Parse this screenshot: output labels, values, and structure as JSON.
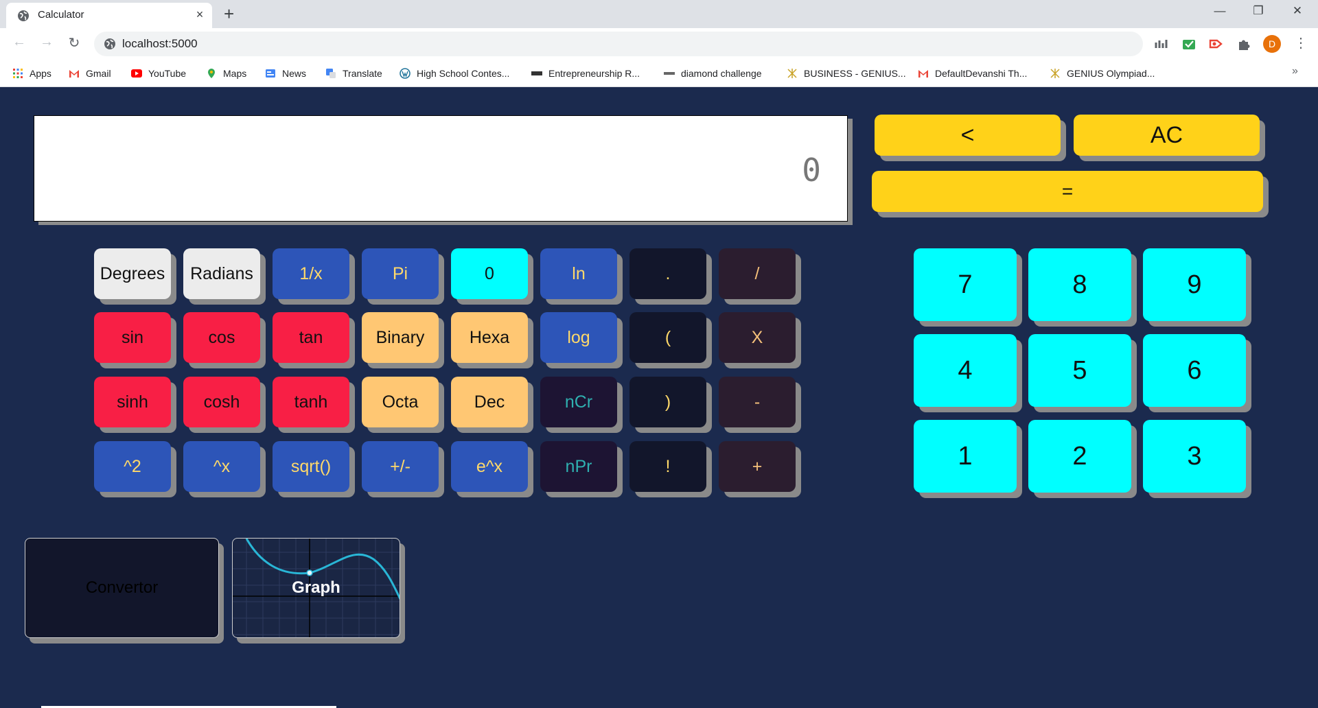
{
  "browser": {
    "tab_title": "Calculator",
    "tab_close": "×",
    "new_tab": "+",
    "window_controls": {
      "minimize": "—",
      "maximize": "❐",
      "close": "✕"
    },
    "nav": {
      "back": "←",
      "forward": "→",
      "reload": "↻"
    },
    "url": "localhost:5000",
    "avatar_letter": "D",
    "menu": "⋮",
    "bookmarks": [
      {
        "label": "Apps",
        "icon": "apps-grid-icon"
      },
      {
        "label": "Gmail",
        "icon": "gmail-icon"
      },
      {
        "label": "YouTube",
        "icon": "youtube-icon"
      },
      {
        "label": "Maps",
        "icon": "maps-pin-icon"
      },
      {
        "label": "News",
        "icon": "news-icon"
      },
      {
        "label": "Translate",
        "icon": "translate-icon"
      },
      {
        "label": "High School Contes...",
        "icon": "wordpress-icon"
      },
      {
        "label": "Entrepreneurship R...",
        "icon": "site-icon"
      },
      {
        "label": "diamond challenge",
        "icon": "site-icon"
      },
      {
        "label": "BUSINESS - GENIUS...",
        "icon": "genius-icon"
      },
      {
        "label": "DefaultDevanshi Th...",
        "icon": "gmail-icon"
      },
      {
        "label": "GENIUS Olympiad...",
        "icon": "genius-icon"
      }
    ],
    "bookmarks_more": "»"
  },
  "calculator": {
    "display_value": "0",
    "top_keys": {
      "backspace": "<",
      "clear": "AC",
      "equals": "="
    },
    "scientific_keys": [
      [
        "Degrees",
        "Radians",
        "1/x",
        "Pi",
        "0",
        "ln",
        ".",
        "/"
      ],
      [
        "sin",
        "cos",
        "tan",
        "Binary",
        "Hexa",
        "log",
        "(",
        "X"
      ],
      [
        "sinh",
        "cosh",
        "tanh",
        "Octa",
        "Dec",
        "nCr",
        ")",
        "-"
      ],
      [
        "^2",
        "^x",
        "sqrt()",
        "+/-",
        "e^x",
        "nPr",
        "!",
        "+"
      ]
    ],
    "number_keys": [
      [
        "7",
        "8",
        "9"
      ],
      [
        "4",
        "5",
        "6"
      ],
      [
        "1",
        "2",
        "3"
      ]
    ],
    "cards": {
      "convertor": "Convertor",
      "graph": "Graph"
    }
  },
  "colors": {
    "background": "#1b2a4e",
    "yellow": "#ffd219",
    "cyan": "#00ffff",
    "red": "#f81f45",
    "blue": "#2d55b8",
    "peach": "#ffc773"
  }
}
